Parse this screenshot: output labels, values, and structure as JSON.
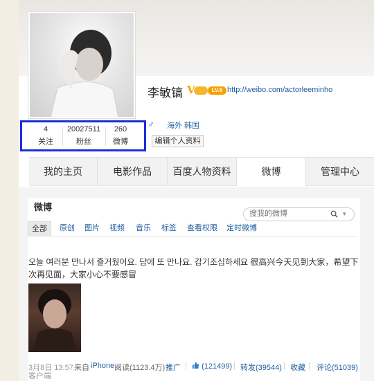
{
  "profile": {
    "name": "李敏镐",
    "verify_mark": "V",
    "vip_label": "LV.6",
    "url": "http://weibo.com/actorleeminho",
    "gender_symbol": "♂",
    "location": "海外 韩国",
    "edit_button": "编辑个人资料"
  },
  "stats": [
    {
      "value": "4",
      "label": "关注"
    },
    {
      "value": "20027511",
      "label": "粉丝"
    },
    {
      "value": "260",
      "label": "微博"
    }
  ],
  "tabs": [
    {
      "label": "我的主页",
      "active": false
    },
    {
      "label": "电影作品",
      "active": false
    },
    {
      "label": "百度人物资料",
      "active": false
    },
    {
      "label": "微博",
      "active": true
    },
    {
      "label": "管理中心",
      "active": false
    }
  ],
  "feed": {
    "title": "微博",
    "search_placeholder": "搜我的微博",
    "filters": [
      "全部",
      "原创",
      "图片",
      "视频",
      "音乐",
      "标签",
      "查看权限",
      "定时微博"
    ]
  },
  "post": {
    "text": "오늘 여러분 만나서 즐거웠어요. 담에 또 만나요. 감기조심하세요 很高兴今天见到大家，希望下次再见面，大家小心不要感冒",
    "date": "3月8日 13:57",
    "source_prefix": "来自",
    "source": "iPhone",
    "source_suffix": "客户端",
    "reads": "阅读(1123.4万)",
    "promote": "推广",
    "likes": "(121499)",
    "reposts": "转发(39544)",
    "favorite": "收藏",
    "comments": "评论(51039)"
  },
  "colors": {
    "highlight_box": "#1b2bdc",
    "link": "#1f5c9e",
    "vip": "#f8a000"
  }
}
